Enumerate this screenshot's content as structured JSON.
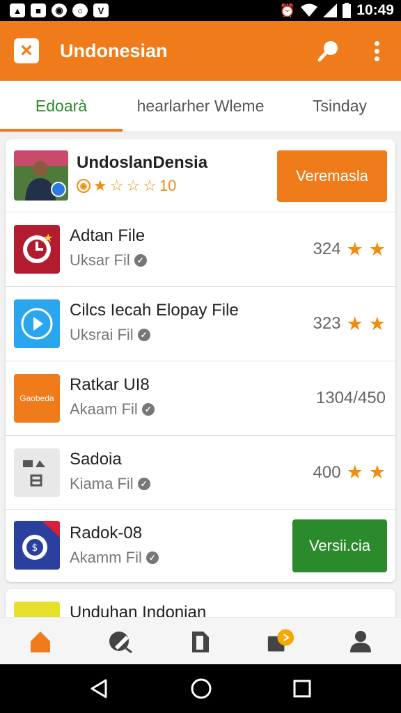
{
  "status_bar": {
    "time": "10:49",
    "left_icons": [
      "image-icon",
      "bag-icon",
      "circle-icon",
      "ring-icon",
      "v-icon"
    ],
    "right_icons": [
      "alarm-icon",
      "wifi-icon",
      "signal-icon",
      "battery-icon"
    ]
  },
  "app_bar": {
    "title": "Undonesian",
    "close_icon": "close-icon",
    "search_icon": "search-icon",
    "more_icon": "more-vert-icon",
    "color": "#f07b1a"
  },
  "tabs": [
    {
      "label": "Edoarà",
      "active": true
    },
    {
      "label": "hearlarher Wleme",
      "active": false
    },
    {
      "label": "Tsinday",
      "active": false
    }
  ],
  "featured": {
    "name": "UndoslanDensia",
    "rating_text": "10",
    "stars": 4,
    "button": "Veremasla"
  },
  "items": [
    {
      "name": "Adtan File",
      "sub": "Uksar Fil",
      "value": "324",
      "stars": 2,
      "thumb_color": "#b31b2e"
    },
    {
      "name": "Cilcs Iecah Elopay File",
      "sub": "Uksrai Fil",
      "value": "323",
      "stars": 2,
      "thumb_color": "#2aa6ee"
    },
    {
      "name": "Ratkar UI8",
      "sub": "Akaam Fil",
      "value": "1304/450",
      "stars": 0,
      "thumb_color": "#f07b1a",
      "thumb_text": "Gaobeda"
    },
    {
      "name": "Sadoia",
      "sub": "Kiama Fil",
      "value": "400",
      "stars": 2,
      "thumb_color": "#e8e8e8"
    },
    {
      "name": "Radok-08",
      "sub": "Akamm Fil",
      "button": "Versii.cia",
      "thumb_color": "#2b3f9e"
    }
  ],
  "partial_item": {
    "name": "Unduhan Indonian"
  },
  "bottom_nav": [
    "home-icon",
    "edit-icon",
    "bookmark-icon",
    "message-icon",
    "profile-icon"
  ],
  "system_nav": [
    "back-icon",
    "home-circle-icon",
    "recents-icon"
  ]
}
